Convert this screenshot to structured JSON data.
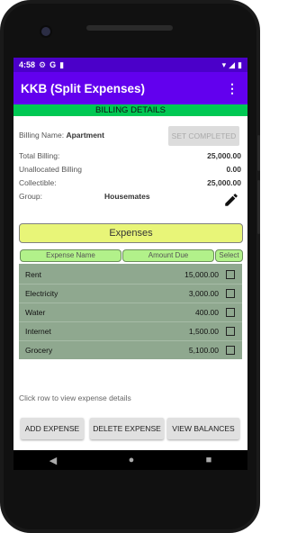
{
  "status_bar": {
    "time": "4:58",
    "icons_left": [
      "settings-icon",
      "google-icon",
      "sim-icon"
    ],
    "icons_right": [
      "wifi-icon",
      "signal-icon",
      "battery-icon"
    ]
  },
  "app_bar": {
    "title": "KKB (Split Expenses)",
    "menu_icon": "more-vert-icon",
    "color": "#6200ee"
  },
  "banner": {
    "text": "BILLING DETAILS",
    "color": "#00c853"
  },
  "billing": {
    "name_label": "Billing Name:",
    "name_value": "Apartment",
    "set_completed_label": "SET COMPLETED",
    "total_label": "Total Billing:",
    "total_value": "25,000.00",
    "unallocated_label": "Unallocated Billing",
    "unallocated_value": "0.00",
    "collectible_label": "Collectible:",
    "collectible_value": "25,000.00",
    "group_label": "Group:",
    "group_value": "Housemates",
    "edit_icon": "pencil-icon"
  },
  "expenses": {
    "title": "Expenses",
    "columns": [
      "Expense Name",
      "Amount Due",
      "Select"
    ],
    "rows": [
      {
        "name": "Rent",
        "amount": "15,000.00",
        "selected": false
      },
      {
        "name": "Electricity",
        "amount": "3,000.00",
        "selected": false
      },
      {
        "name": "Water",
        "amount": "400.00",
        "selected": false
      },
      {
        "name": "Internet",
        "amount": "1,500.00",
        "selected": false
      },
      {
        "name": "Grocery",
        "amount": "5,100.00",
        "selected": false
      }
    ]
  },
  "hint": "Click row to view expense details",
  "buttons": {
    "add": "ADD EXPENSE",
    "delete": "DELETE EXPENSE",
    "view": "VIEW BALANCES"
  },
  "nav": {
    "back": "◀",
    "home": "●",
    "recents": "■"
  }
}
